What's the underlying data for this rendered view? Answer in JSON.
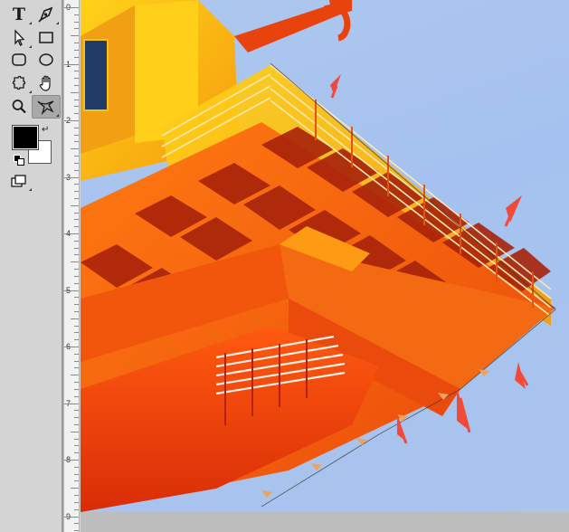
{
  "toolbar": {
    "tools": [
      {
        "name": "type-tool",
        "glyph": "T"
      },
      {
        "name": "pen-tool",
        "icon": "pen-icon"
      },
      {
        "name": "path-selection-tool",
        "icon": "arrow-select-icon"
      },
      {
        "name": "rectangle-tool",
        "icon": "rectangle-icon"
      },
      {
        "name": "rounded-rectangle-tool",
        "icon": "rounded-rectangle-icon"
      },
      {
        "name": "ellipse-tool",
        "icon": "ellipse-icon"
      },
      {
        "name": "custom-shape-tool",
        "icon": "puzzle-shape-icon"
      },
      {
        "name": "hand-tool",
        "icon": "hand-icon"
      },
      {
        "name": "zoom-tool",
        "icon": "magnifier-icon"
      },
      {
        "name": "3d-tool",
        "icon": "3d-rotate-icon",
        "active": true
      }
    ],
    "foreground_color": "#000000",
    "background_color": "#ffffff",
    "accent_highlight": "#a9a9a9"
  },
  "ruler": {
    "labels": [
      "0",
      "1",
      "2",
      "3",
      "4",
      "5",
      "6",
      "7",
      "8",
      "9"
    ]
  },
  "canvas": {
    "subject": "orange-crane-cabin",
    "sky_color": "#a9c4ee",
    "annotation_color": "#f24a3a"
  }
}
